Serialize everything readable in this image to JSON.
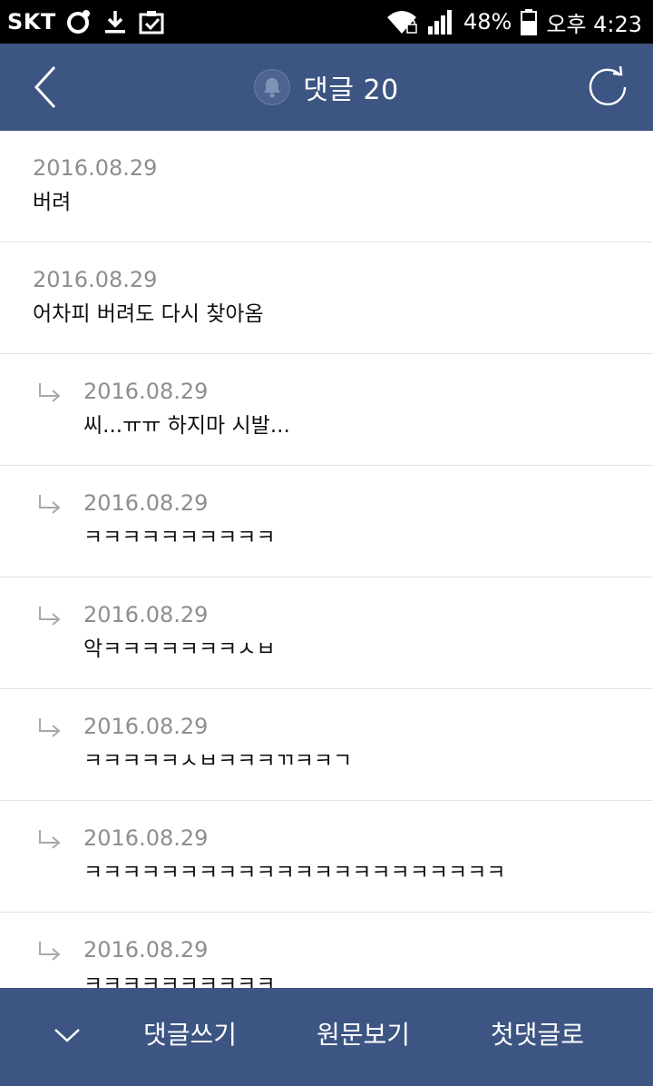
{
  "status_bar": {
    "carrier": "SKT",
    "battery": "48%",
    "time": "오후 4:23"
  },
  "header": {
    "title": "댓글 20"
  },
  "comments": [
    {
      "date": "2016.08.29",
      "text": "버려",
      "reply": false
    },
    {
      "date": "2016.08.29",
      "text": "어차피 버려도 다시 찾아옴",
      "reply": false
    },
    {
      "date": "2016.08.29",
      "text": "씨...ㅠㅠ 하지마 시발...",
      "reply": true
    },
    {
      "date": "2016.08.29",
      "text": "ㅋㅋㅋㅋㅋㅋㅋㅋㅋㅋ",
      "reply": true
    },
    {
      "date": "2016.08.29",
      "text": "악ㅋㅋㅋㅋㅋㅋㅋㅅㅂ",
      "reply": true
    },
    {
      "date": "2016.08.29",
      "text": "ㅋㅋㅋㅋㅋㅅㅂㅋㅋㅋㄲㅋㅋㄱ",
      "reply": true
    },
    {
      "date": "2016.08.29",
      "text": "ㅋㅋㅋㅋㅋㅋㅋㅋㅋㅋㅋㅋㅋㅋㅋㅋㅋㅋㅋㅋㅋㅋ",
      "reply": true
    },
    {
      "date": "2016.08.29",
      "text": "ㅋㅋㅋㅋㅋㅋㅋㅋㅋㅋ",
      "reply": true
    }
  ],
  "bottom_bar": {
    "write_label": "댓글쓰기",
    "original_label": "원문보기",
    "first_label": "첫댓글로"
  },
  "colors": {
    "header_bg": "#3c5582",
    "status_bg": "#000000",
    "date_text": "#8e8e8e",
    "divider": "#e2e2e2"
  }
}
